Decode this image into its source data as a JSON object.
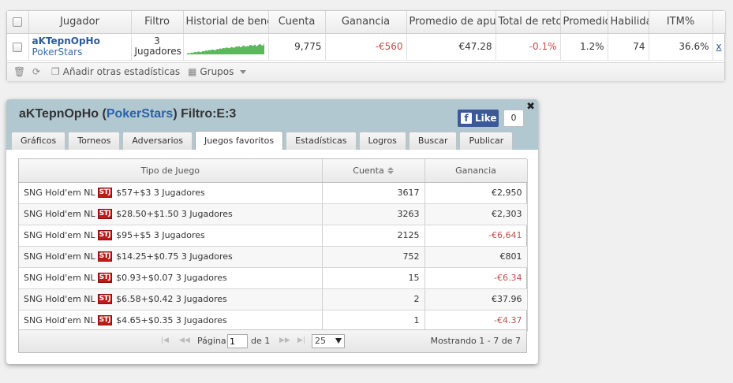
{
  "top_grid": {
    "headers": [
      "Jugador",
      "Filtro",
      "Historial de benef",
      "Cuenta",
      "Ganancia",
      "Promedio de apues",
      "Total de reto",
      "Promedio",
      "Habilida",
      "ITM%"
    ],
    "row": {
      "player_name": "aKTepnOpHo",
      "player_site": "PokerStars",
      "filter_line1": "3",
      "filter_line2": "Jugadores",
      "cuenta": "9,775",
      "ganancia": "-€560",
      "promedio_apuesta": "€47.28",
      "total_retorno": "-0.1%",
      "promedio": "1.2%",
      "habilidad": "74",
      "itm": "36.6%",
      "remove": "x"
    },
    "sparkline": [
      2,
      3,
      2,
      4,
      3,
      5,
      4,
      6,
      5,
      4,
      7,
      6,
      8,
      7,
      9,
      8,
      10,
      9,
      8,
      11,
      10,
      12,
      11,
      13,
      12,
      14,
      13,
      12,
      15,
      14,
      13,
      16,
      15,
      17,
      14,
      16,
      18,
      15,
      17,
      16,
      19,
      18,
      17,
      20,
      16,
      18,
      21,
      19,
      17,
      22
    ],
    "colors": {
      "sparkline": "#5cb85c",
      "negative": "#c0504d"
    }
  },
  "toolbar": {
    "add_stats": "Añadir otras estadísticas",
    "groups": "Grupos"
  },
  "popup": {
    "title_player": "aKTepnOpHo",
    "title_site": "PokerStars",
    "title_filter": "Filtro:E:3",
    "like_label": "Like",
    "like_count": "0",
    "tabs": [
      "Gráficos",
      "Torneos",
      "Adversarios",
      "Juegos favoritos",
      "Estadísticas",
      "Logros",
      "Buscar",
      "Publicar"
    ],
    "active_tab": "Juegos favoritos"
  },
  "games": {
    "headers": {
      "type": "Tipo de Juego",
      "count": "Cuenta",
      "profit": "Ganancia"
    },
    "rows": [
      {
        "game": "SNG Hold'em NL",
        "badge": "STJ",
        "stake": "$57+$3 3 Jugadores",
        "count": "3617",
        "profit": "€2,950",
        "negative": false
      },
      {
        "game": "SNG Hold'em NL",
        "badge": "STJ",
        "stake": "$28.50+$1.50 3 Jugadores",
        "count": "3263",
        "profit": "€2,303",
        "negative": false
      },
      {
        "game": "SNG Hold'em NL",
        "badge": "STJ",
        "stake": "$95+$5 3 Jugadores",
        "count": "2125",
        "profit": "-€6,641",
        "negative": true
      },
      {
        "game": "SNG Hold'em NL",
        "badge": "STJ",
        "stake": "$14.25+$0.75 3 Jugadores",
        "count": "752",
        "profit": "€801",
        "negative": false
      },
      {
        "game": "SNG Hold'em NL",
        "badge": "STJ",
        "stake": "$0.93+$0.07 3 Jugadores",
        "count": "15",
        "profit": "-€6.34",
        "negative": true
      },
      {
        "game": "SNG Hold'em NL",
        "badge": "STJ",
        "stake": "$6.58+$0.42 3 Jugadores",
        "count": "2",
        "profit": "€37.96",
        "negative": false
      },
      {
        "game": "SNG Hold'em NL",
        "badge": "STJ",
        "stake": "$4.65+$0.35 3 Jugadores",
        "count": "1",
        "profit": "-€4.37",
        "negative": true
      }
    ],
    "pager": {
      "page_label": "Página",
      "page_value": "1",
      "of_label": "de 1",
      "page_size": "25",
      "summary": "Mostrando 1 - 7 de 7"
    }
  }
}
